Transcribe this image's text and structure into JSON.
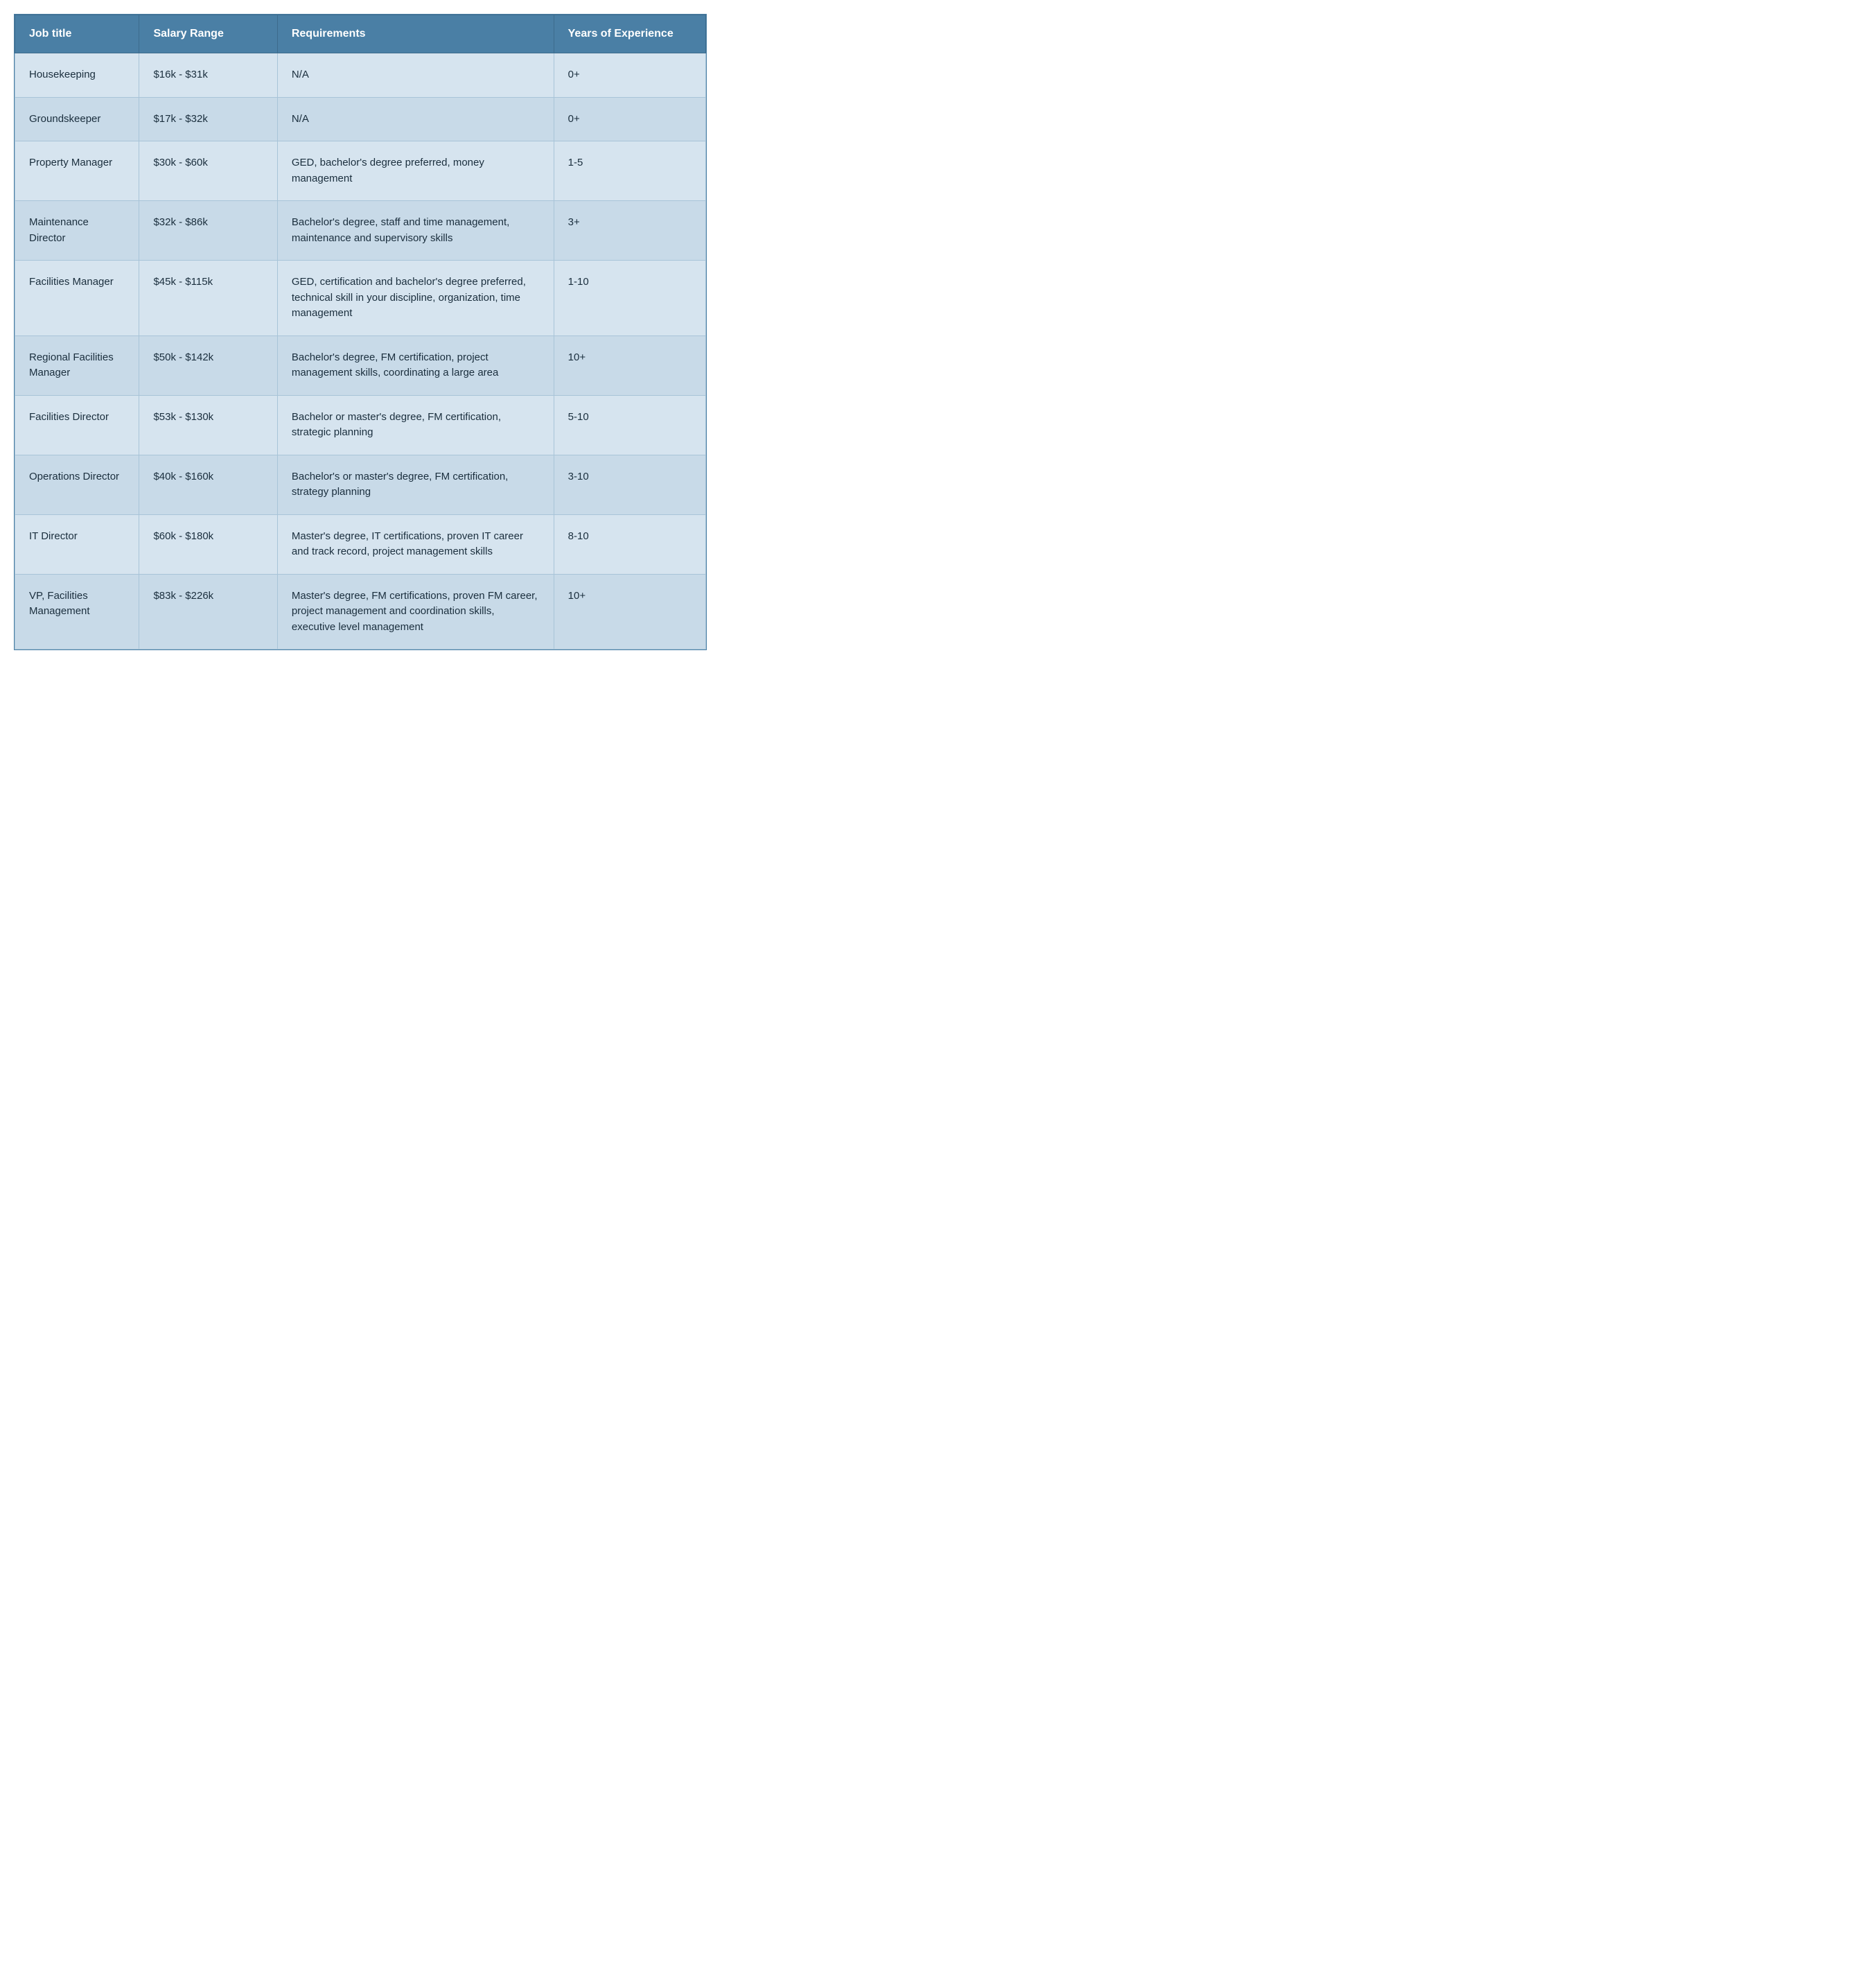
{
  "table": {
    "headers": {
      "job_title": "Job title",
      "salary_range": "Salary Range",
      "requirements": "Requirements",
      "years_experience": "Years of Experience"
    },
    "rows": [
      {
        "job_title": "Housekeeping",
        "salary_range": "$16k - $31k",
        "requirements": "N/A",
        "years_experience": "0+"
      },
      {
        "job_title": "Groundskeeper",
        "salary_range": "$17k - $32k",
        "requirements": "N/A",
        "years_experience": "0+"
      },
      {
        "job_title": "Property Manager",
        "salary_range": "$30k - $60k",
        "requirements": "GED, bachelor's degree preferred, money management",
        "years_experience": "1-5"
      },
      {
        "job_title": "Maintenance Director",
        "salary_range": "$32k - $86k",
        "requirements": "Bachelor's degree, staff and time management, maintenance and supervisory skills",
        "years_experience": "3+"
      },
      {
        "job_title": "Facilities Manager",
        "salary_range": "$45k - $115k",
        "requirements": "GED, certification and bachelor's degree preferred, technical skill in your discipline, organization, time management",
        "years_experience": "1-10"
      },
      {
        "job_title": "Regional Facilities Manager",
        "salary_range": "$50k - $142k",
        "requirements": "Bachelor's degree, FM certification,  project management skills, coordinating a large area",
        "years_experience": "10+"
      },
      {
        "job_title": "Facilities Director",
        "salary_range": "$53k - $130k",
        "requirements": "Bachelor or master's degree, FM certification, strategic planning",
        "years_experience": "5-10"
      },
      {
        "job_title": "Operations Director",
        "salary_range": "$40k - $160k",
        "requirements": "Bachelor's or master's degree, FM certification, strategy planning",
        "years_experience": "3-10"
      },
      {
        "job_title": "IT Director",
        "salary_range": "$60k - $180k",
        "requirements": "Master's degree, IT certifications, proven IT career and track record, project management skills",
        "years_experience": "8-10"
      },
      {
        "job_title": "VP, Facilities Management",
        "salary_range": "$83k - $226k",
        "requirements": "Master's degree, FM certifications, proven FM career, project management and coordination skills, executive level management",
        "years_experience": "10+"
      }
    ]
  }
}
